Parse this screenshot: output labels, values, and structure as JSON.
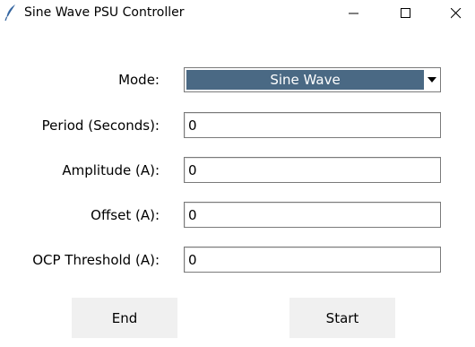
{
  "window": {
    "title": "Sine Wave PSU Controller",
    "icon": "feather-icon",
    "controls": [
      "minimize-icon",
      "maximize-icon",
      "close-icon"
    ]
  },
  "form": {
    "mode": {
      "label": "Mode:",
      "selected": "Sine Wave"
    },
    "period": {
      "label": "Period (Seconds):",
      "value": "0"
    },
    "amplitude": {
      "label": "Amplitude (A):",
      "value": "0"
    },
    "offset": {
      "label": "Offset (A):",
      "value": "0"
    },
    "ocp_threshold": {
      "label": "OCP Threshold (A):",
      "value": "0"
    }
  },
  "buttons": {
    "end_label": "End",
    "start_label": "Start"
  },
  "colors": {
    "selection": "#4a6984",
    "button_bg": "#f0f0f0"
  }
}
